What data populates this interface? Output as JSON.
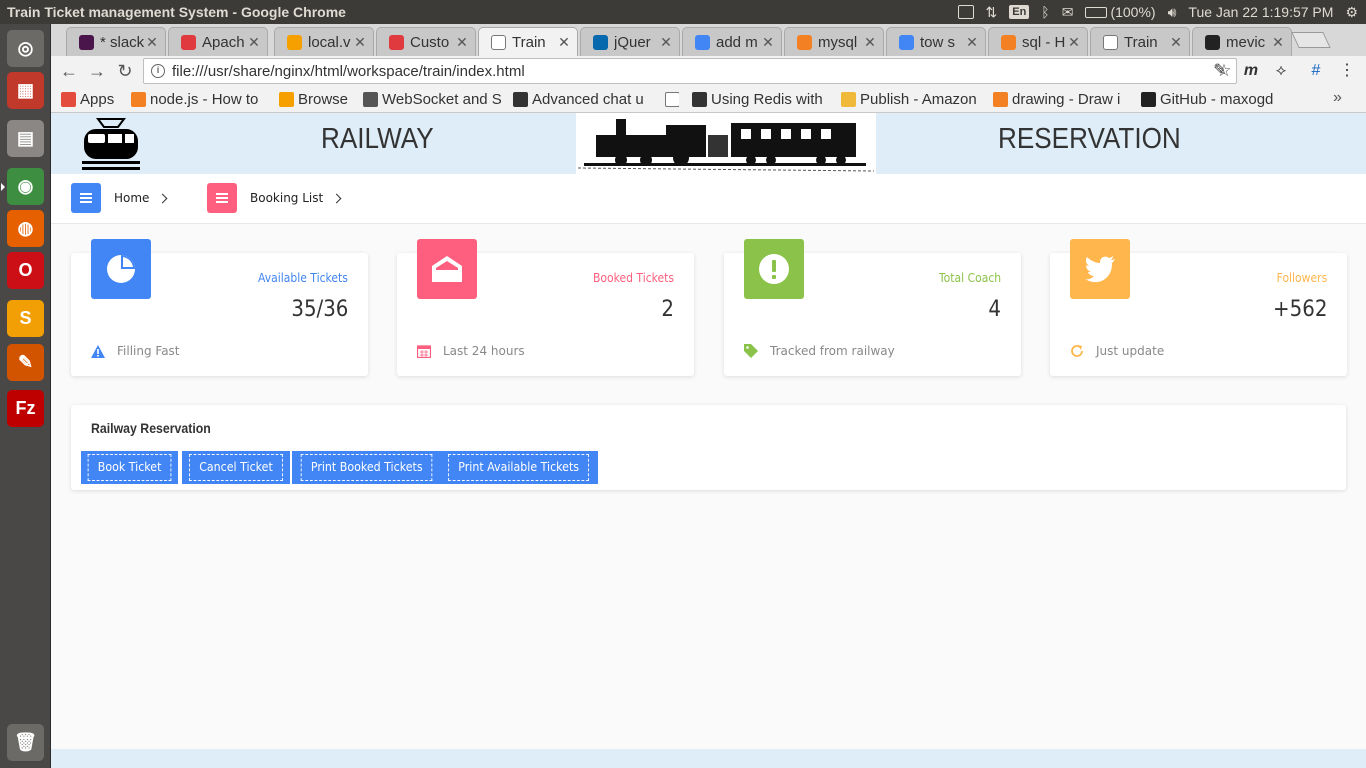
{
  "window_title": "Train Ticket management System - Google Chrome",
  "system_tray": {
    "language": "En",
    "battery": "(100%)",
    "clock": "Tue Jan 22  1:19:57 PM"
  },
  "launcher": [
    {
      "name": "ubuntu-dash-icon",
      "color": "#6b6a66"
    },
    {
      "name": "system-monitor-icon",
      "color": "#c0392b"
    },
    {
      "name": "files-icon",
      "color": "#8a8784"
    },
    {
      "name": "chrome-icon",
      "color": "#3e8e41"
    },
    {
      "name": "firefox-icon",
      "color": "#e66000"
    },
    {
      "name": "opera-icon",
      "color": "#cc0f16"
    },
    {
      "name": "sublime-text-icon",
      "color": "#f29f05"
    },
    {
      "name": "text-editor-icon",
      "color": "#d35400"
    },
    {
      "name": "filezilla-icon",
      "color": "#bf0000"
    },
    {
      "name": "trash-icon",
      "color": "#6b6a66"
    }
  ],
  "tabs": [
    {
      "label": "* slack",
      "favicon_color": "#4a154b"
    },
    {
      "label": "Apach",
      "favicon_color": "#e03a3e"
    },
    {
      "label": "local.v",
      "favicon_color": "#f6a000"
    },
    {
      "label": "Custo",
      "favicon_color": "#e03a3e"
    },
    {
      "label": "Train",
      "favicon_color": "#ffffff",
      "active": true
    },
    {
      "label": "jQuer",
      "favicon_color": "#0769ad"
    },
    {
      "label": "add m",
      "favicon_color": "#4285f4"
    },
    {
      "label": "mysql",
      "favicon_color": "#f48024"
    },
    {
      "label": "tow s",
      "favicon_color": "#4285f4"
    },
    {
      "label": "sql - H",
      "favicon_color": "#f48024"
    },
    {
      "label": "Train",
      "favicon_color": "#ffffff"
    },
    {
      "label": "mevic",
      "favicon_color": "#222222"
    }
  ],
  "address_bar": {
    "url": "file:///usr/share/nginx/html/workspace/train/index.html"
  },
  "bookmarks": [
    {
      "label": "Apps",
      "icon_color": "#e34b3c"
    },
    {
      "label": "node.js - How to",
      "icon_color": "#f48024"
    },
    {
      "label": "Browse",
      "icon_color": "#f6a000"
    },
    {
      "label": "WebSocket and S",
      "icon_color": "#555555"
    },
    {
      "label": "Advanced chat u",
      "icon_color": "#333333"
    },
    {
      "label": "",
      "icon_color": "#ffffff"
    },
    {
      "label": "Using Redis with",
      "icon_color": "#333333"
    },
    {
      "label": "Publish - Amazon",
      "icon_color": "#f0b93a"
    },
    {
      "label": "drawing - Draw i",
      "icon_color": "#f48024"
    },
    {
      "label": "GitHub - maxogd",
      "icon_color": "#222222"
    }
  ],
  "header": {
    "left_title": "RAILWAY",
    "right_title": "RESERVATION"
  },
  "breadcrumb": {
    "home": "Home",
    "booking_list": "Booking List"
  },
  "stats": [
    {
      "title": "Available Tickets",
      "value": "35/36",
      "footer": "Filling Fast",
      "color": "#4285f4",
      "icon": "pie-chart-icon",
      "footer_icon": "warning-icon"
    },
    {
      "title": "Booked Tickets",
      "value": "2",
      "footer": "Last 24 hours",
      "color": "#ff5f7e",
      "icon": "home-icon",
      "footer_icon": "calendar-icon"
    },
    {
      "title": "Total Coach",
      "value": "4",
      "footer": "Tracked from railway",
      "color": "#8bc34a",
      "icon": "exclamation-icon",
      "footer_icon": "tag-icon"
    },
    {
      "title": "Followers",
      "value": "+562",
      "footer": "Just update",
      "color": "#ffb64d",
      "icon": "twitter-icon",
      "footer_icon": "refresh-icon"
    }
  ],
  "reservation": {
    "title": "Railway Reservation",
    "buttons": [
      "Book Ticket",
      "Cancel Ticket",
      "Print Booked Tickets",
      "Print Available Tickets"
    ]
  }
}
